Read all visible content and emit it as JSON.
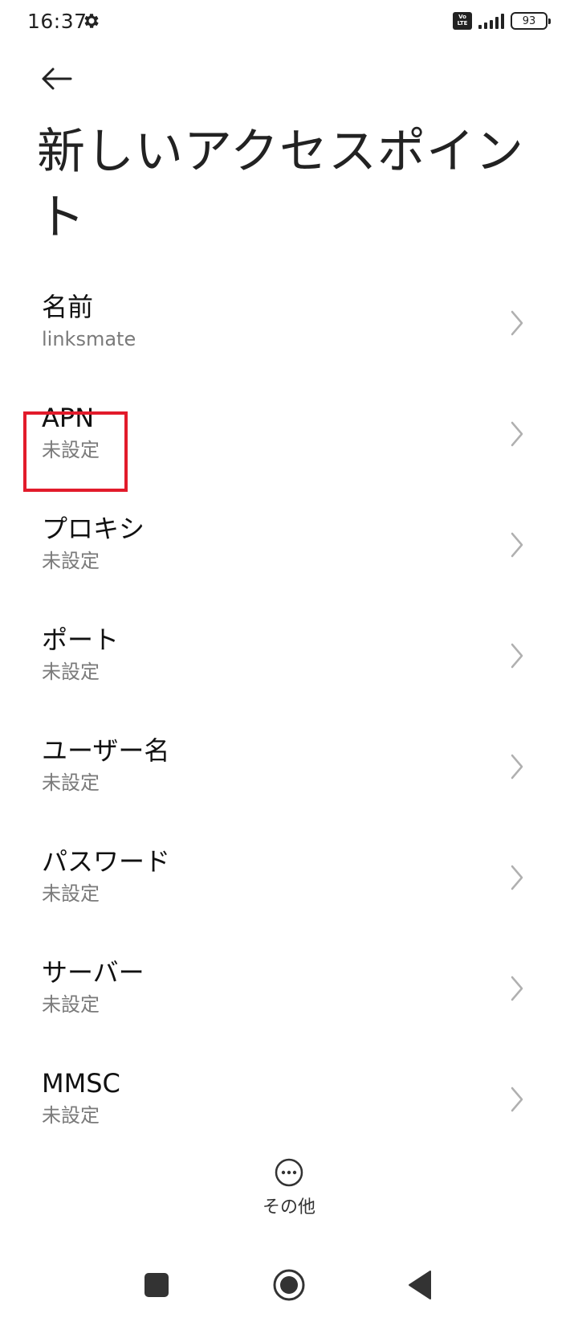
{
  "status_bar": {
    "time": "16:37",
    "battery": "93"
  },
  "page": {
    "title": "新しいアクセスポイント"
  },
  "settings": {
    "items": [
      {
        "label": "名前",
        "value": "linksmate"
      },
      {
        "label": "APN",
        "value": "未設定"
      },
      {
        "label": "プロキシ",
        "value": "未設定"
      },
      {
        "label": "ポート",
        "value": "未設定"
      },
      {
        "label": "ユーザー名",
        "value": "未設定"
      },
      {
        "label": "パスワード",
        "value": "未設定"
      },
      {
        "label": "サーバー",
        "value": "未設定"
      },
      {
        "label": "MMSC",
        "value": "未設定"
      }
    ]
  },
  "footer": {
    "more_label": "その他"
  },
  "colors": {
    "highlight": "#e21b2b",
    "secondary_text": "#7a7a7a"
  }
}
